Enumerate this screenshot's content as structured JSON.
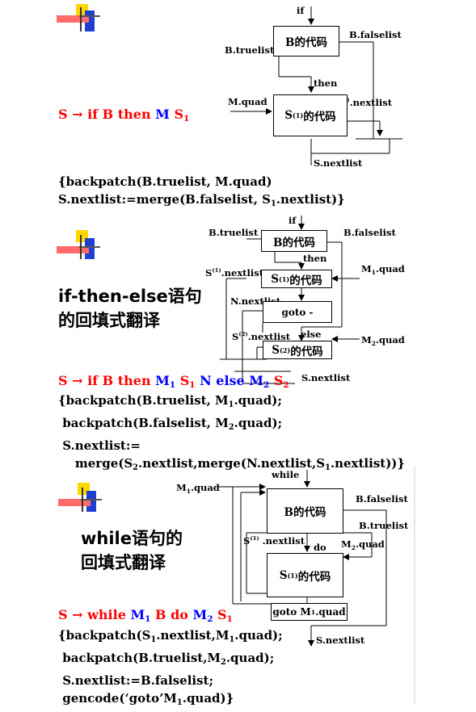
{
  "sec1": {
    "if": "if",
    "b_box": "B的代码",
    "b_falselist": "B.falselist",
    "b_truelist": "B.truelist",
    "then": "then",
    "m_quad": "M.quad",
    "s1_nextlist": ".nextlist",
    "s1_box": "的代码",
    "s_nextlist": "S.nextlist",
    "prod_s": "S",
    "prod_arrow": "→",
    "prod_if": "if B then",
    "prod_M": "M",
    "prod_S1": "S",
    "prod_S1_sub": "1",
    "code1": "{backpatch(B.truelist, M.quad)",
    "code2_a": "S.nextlist:=merge(B.falselist, S",
    "code2_sub": "1",
    "code2_b": ".nextlist)}"
  },
  "sec2": {
    "if": "if",
    "b_box": "B的代码",
    "b_truelist": "B.truelist",
    "b_falselist": "B.falselist",
    "then": "then",
    "s1_nextlist": ".nextlist",
    "s1_box": "的代码",
    "m1_quad": ".quad",
    "n_nextlist": "N.nextlist",
    "goto_box": "goto -",
    "s2_nextlist": ".nextlist",
    "else": "else",
    "s2_box": "的代码",
    "m2_quad": ".quad",
    "s_nextlist": "S.nextlist",
    "title1": "if-then-else语句",
    "title2": "的回填式翻译",
    "code1": "{backpatch(B.truelist, M",
    "code1_b": ".quad);",
    "code2": "backpatch(B.falselist, M",
    "code2_b": ".quad);",
    "code3": "S.nextlist:=",
    "code4_a": "merge(S",
    "code4_b": ".nextlist,merge(N.nextlist,S",
    "code4_c": ".nextlist))}"
  },
  "sec3": {
    "while": "while",
    "m1_quad": ".quad",
    "b_box": "B的代码",
    "b_falselist": "B.falselist",
    "b_truelist": "B.truelist",
    "s1_nextlist": " .nextlist",
    "do": "do",
    "m2_quad": ".quad",
    "s1_box": "的代码",
    "goto_box": "goto M",
    "goto_box_b": ".quad",
    "s_nextlist": "S.nextlist",
    "title1": "while语句的",
    "title2": "回填式翻译",
    "code1_a": "{backpatch(S",
    "code1_b": ".nextlist,M",
    "code1_c": ".quad);",
    "code2": "backpatch(B.truelist,M",
    "code2_b": ".quad);",
    "code3": "S.nextlist:=B.falselist;",
    "code4_a": "gencode(‘goto’M",
    "code4_b": ".quad)}"
  },
  "common": {
    "sub1": "1",
    "sub2": "2",
    "sup1": "(1)",
    "sup2": "(2)"
  },
  "colors": {
    "red": "#ff0000",
    "blue": "#0000ff",
    "yellow": "#ffd700",
    "deco_blue": "#1f3fd0",
    "deco_red": "#ff5a5a"
  }
}
